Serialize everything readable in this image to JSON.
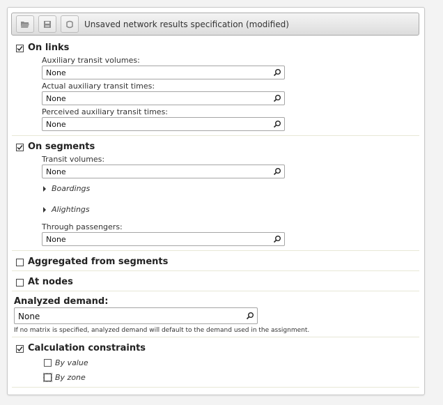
{
  "toolbar": {
    "title": "Unsaved network results specification (modified)",
    "buttons": [
      {
        "icon": "folder-open-icon"
      },
      {
        "icon": "save-icon"
      },
      {
        "icon": "reset-icon"
      }
    ]
  },
  "on_links": {
    "label": "On links",
    "checked": true,
    "fields": [
      {
        "label": "Auxiliary transit volumes:",
        "value": "None"
      },
      {
        "label": "Actual auxiliary transit times:",
        "value": "None"
      },
      {
        "label": "Perceived auxiliary transit times:",
        "value": "None"
      }
    ]
  },
  "on_segments": {
    "label": "On segments",
    "checked": true,
    "transit_volumes": {
      "label": "Transit volumes:",
      "value": "None"
    },
    "boardings": "Boardings",
    "alightings": "Alightings",
    "through_passengers": {
      "label": "Through passengers:",
      "value": "None"
    }
  },
  "aggregated": {
    "label": "Aggregated from segments",
    "checked": false
  },
  "at_nodes": {
    "label": "At nodes",
    "checked": false
  },
  "analyzed_demand": {
    "label": "Analyzed demand:",
    "value": "None",
    "note": "If no matrix is specified, analyzed demand will default to the demand used in the assignment."
  },
  "calc_constraints": {
    "label": "Calculation constraints",
    "checked": true,
    "by_value": "By value",
    "by_zone": "By zone"
  }
}
